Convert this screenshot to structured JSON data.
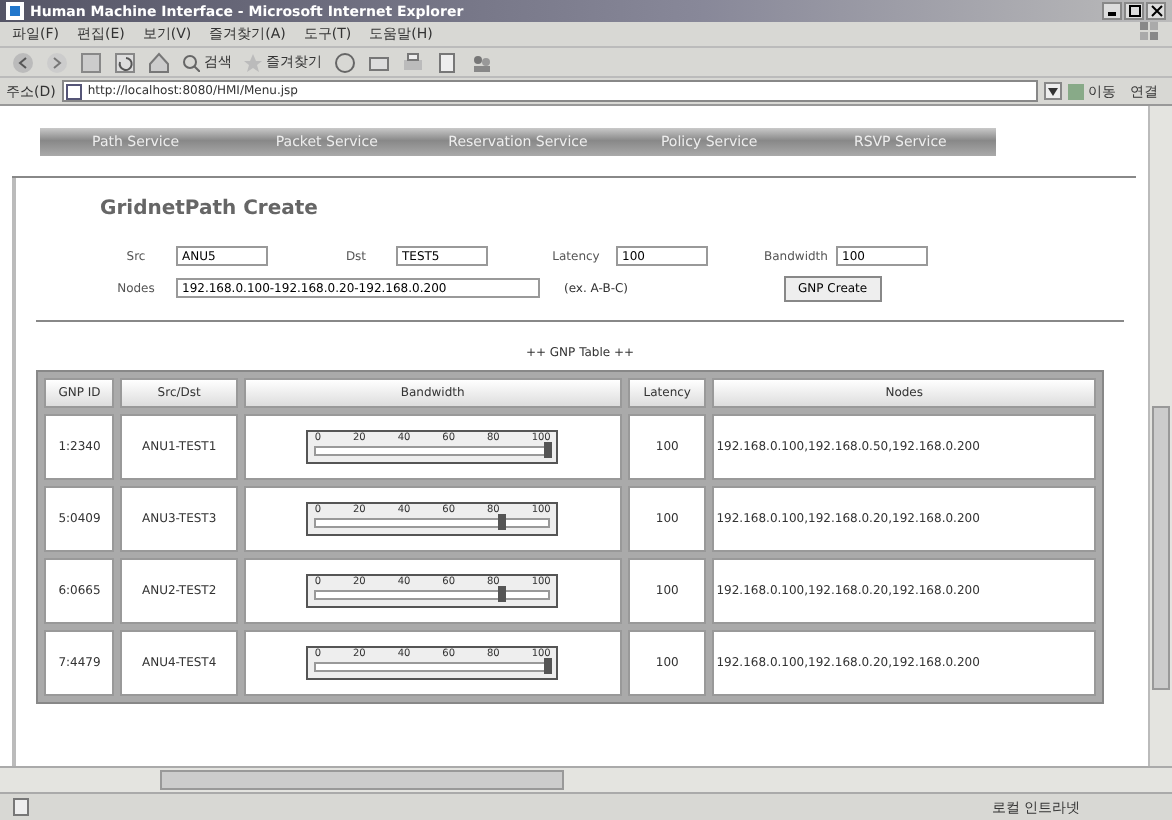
{
  "window": {
    "title": "Human Machine Interface - Microsoft Internet Explorer"
  },
  "menu": [
    "파일(F)",
    "편집(E)",
    "보기(V)",
    "즐겨찾기(A)",
    "도구(T)",
    "도움말(H)"
  ],
  "toolbar": {
    "search": "검색",
    "favorites": "즐겨찾기"
  },
  "address": {
    "label": "주소(D)",
    "value": "http://localhost:8080/HMI/Menu.jsp",
    "go": "이동",
    "links": "연결"
  },
  "tabs": [
    {
      "label": "Path Service"
    },
    {
      "label": "Packet Service"
    },
    {
      "label": "Reservation Service"
    },
    {
      "label": "Policy Service"
    },
    {
      "label": "RSVP Service"
    }
  ],
  "form": {
    "title": "GridnetPath Create",
    "fields": [
      {
        "label": "Src",
        "value": "ANU5"
      },
      {
        "label": "Dst",
        "value": "TEST5"
      },
      {
        "label": "Latency",
        "value": "100"
      },
      {
        "label": "Bandwidth",
        "value": "100"
      }
    ],
    "nodes": {
      "label": "Nodes",
      "value": "192.168.0.100-192.168.0.20-192.168.0.200",
      "hint": "(ex. A-B-C)"
    },
    "button": "GNP Create"
  },
  "table": {
    "caption": "++ GNP Table ++",
    "columns": [
      "GNP ID",
      "Src/Dst",
      "Bandwidth",
      "Latency",
      "Nodes"
    ],
    "rows": [
      {
        "id": "1:2340",
        "pair": "ANU1-TEST1",
        "level": 1.0,
        "ticks": [
          "0",
          "20",
          "40",
          "60",
          "80",
          "100"
        ],
        "latency": "100",
        "nodes": "192.168.0.100,192.168.0.50,192.168.0.200"
      },
      {
        "id": "5:0409",
        "pair": "ANU3-TEST3",
        "level": 0.8,
        "ticks": [
          "0",
          "20",
          "40",
          "60",
          "80",
          "100"
        ],
        "latency": "100",
        "nodes": "192.168.0.100,192.168.0.20,192.168.0.200"
      },
      {
        "id": "6:0665",
        "pair": "ANU2-TEST2",
        "level": 0.8,
        "ticks": [
          "0",
          "20",
          "40",
          "60",
          "80",
          "100"
        ],
        "latency": "100",
        "nodes": "192.168.0.100,192.168.0.20,192.168.0.200"
      },
      {
        "id": "7:4479",
        "pair": "ANU4-TEST4",
        "level": 1.0,
        "ticks": [
          "0",
          "20",
          "40",
          "60",
          "80",
          "100"
        ],
        "latency": "100",
        "nodes": "192.168.0.100,192.168.0.20,192.168.0.200"
      }
    ]
  },
  "status_bar": {
    "zone": "로컬 인트라넷"
  }
}
